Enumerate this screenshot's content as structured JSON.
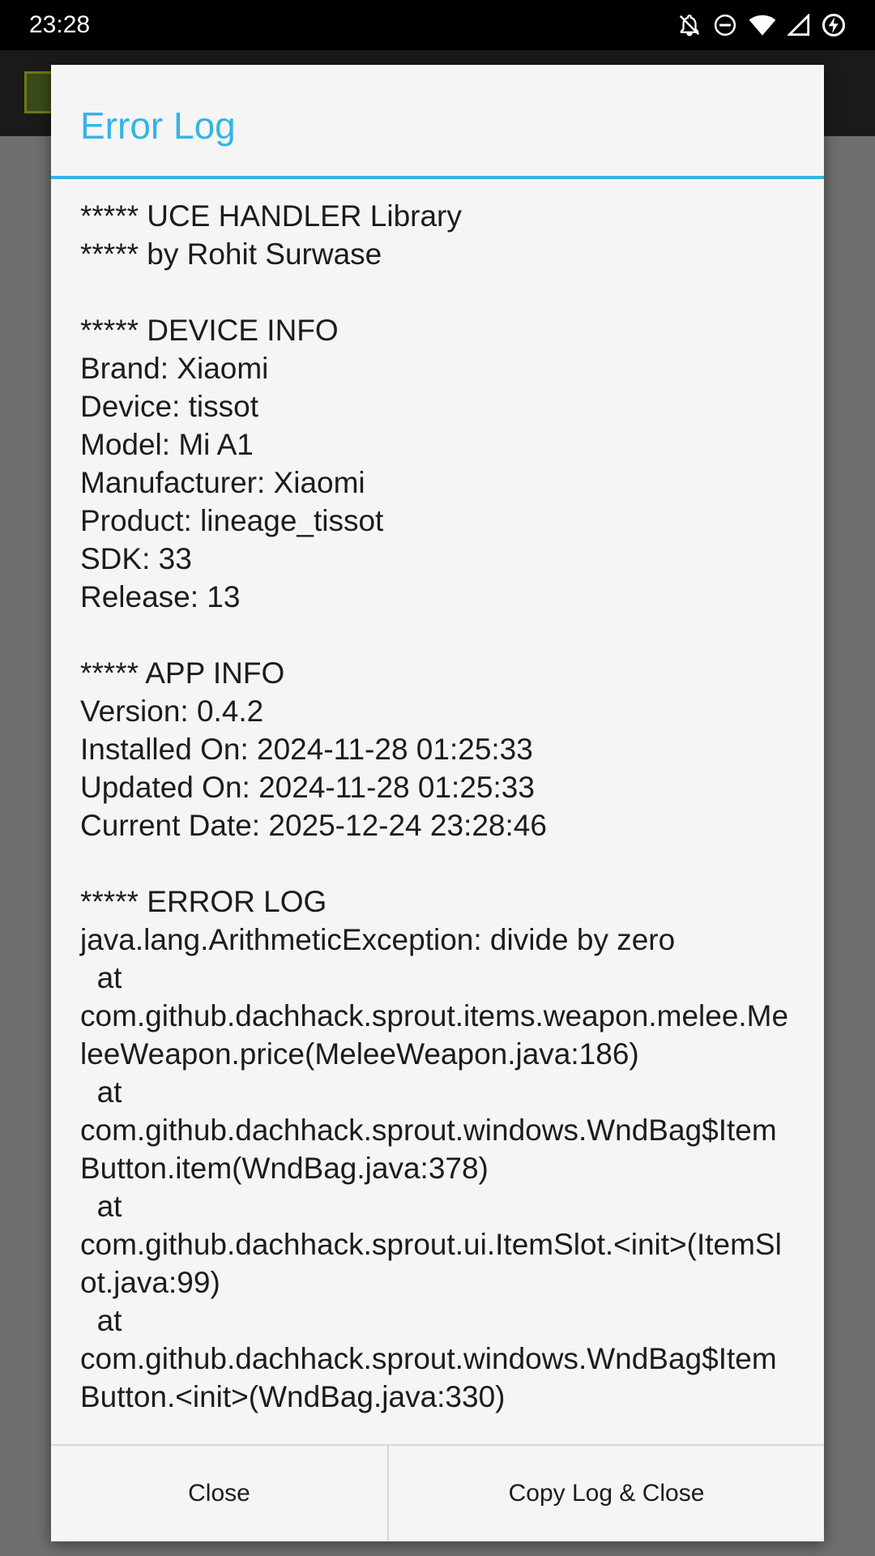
{
  "status_bar": {
    "time": "23:28",
    "icons": [
      "notifications-off-icon",
      "do-not-disturb-icon",
      "wifi-icon",
      "cell-signal-icon",
      "battery-charging-icon"
    ]
  },
  "dialog": {
    "title": "Error Log",
    "log_lines": [
      "***** UCE HANDLER Library",
      "***** by Rohit Surwase",
      "",
      "***** DEVICE INFO",
      "Brand: Xiaomi",
      "Device: tissot",
      "Model: Mi A1",
      "Manufacturer: Xiaomi",
      "Product: lineage_tissot",
      "SDK: 33",
      "Release: 13",
      "",
      "***** APP INFO",
      "Version: 0.4.2",
      "Installed On: 2024-11-28 01:25:33",
      "Updated On: 2024-11-28 01:25:33",
      "Current Date: 2025-12-24 23:28:46",
      "",
      "***** ERROR LOG",
      "java.lang.ArithmeticException: divide by zero",
      "  at",
      "com.github.dachhack.sprout.items.weapon.melee.MeleeWeapon.price(MeleeWeapon.java:186)",
      "  at",
      "com.github.dachhack.sprout.windows.WndBag$ItemButton.item(WndBag.java:378)",
      "  at",
      "com.github.dachhack.sprout.ui.ItemSlot.<init>(ItemSlot.java:99)",
      "  at",
      "com.github.dachhack.sprout.windows.WndBag$ItemButton.<init>(WndBag.java:330)"
    ],
    "buttons": {
      "close": "Close",
      "copy_close": "Copy Log & Close"
    }
  },
  "colors": {
    "accent": "#33b5e5",
    "dialog_background": "#f5f5f5",
    "scrim": "#6f6f6f"
  }
}
